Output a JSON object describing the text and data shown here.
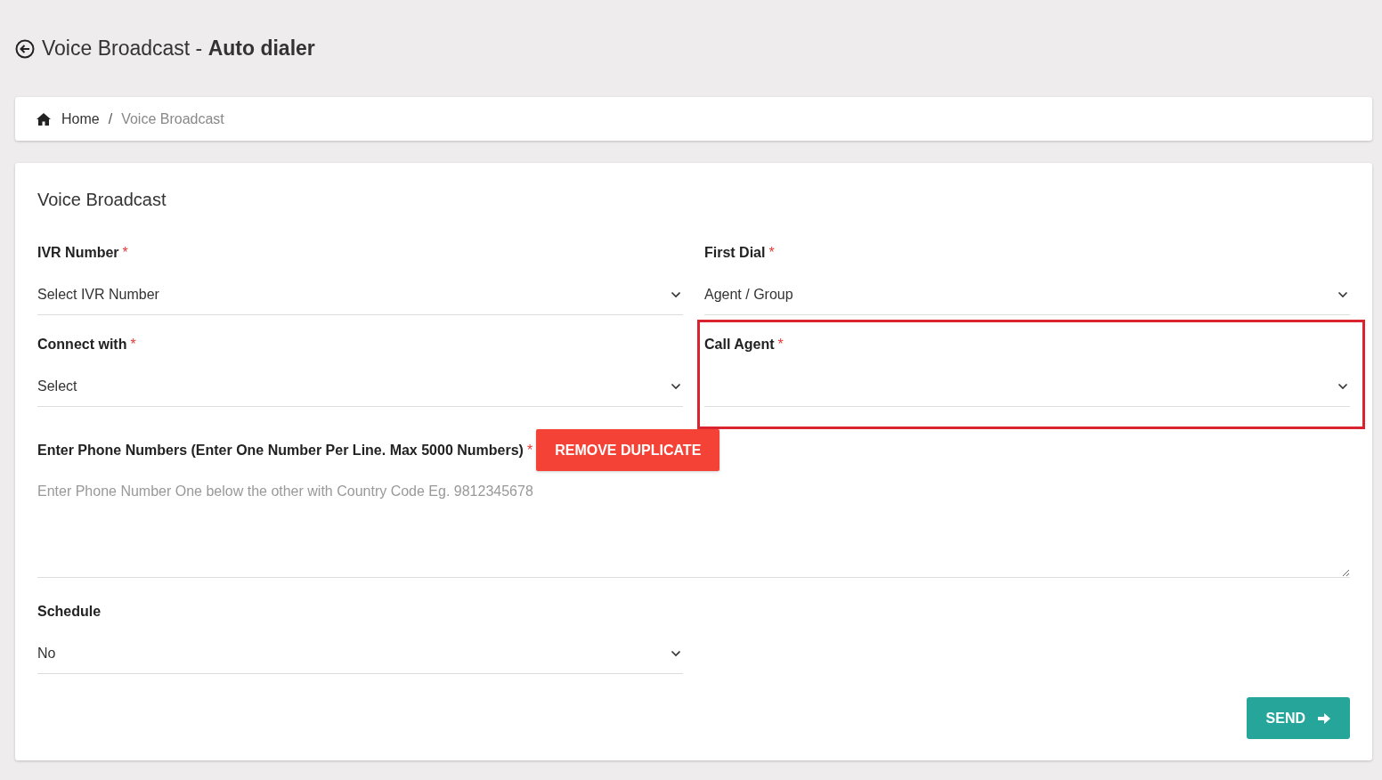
{
  "page_title": "Voice Broadcast - **Auto dialer**",
  "breadcrumb": [
    {
      "label": "Home",
      "kind": "home"
    },
    {
      "label": "Voice Broadcast",
      "kind": "current"
    }
  ],
  "breadcrumb_separator": "/",
  "form": {
    "title": "Voice Broadcast",
    "required_mark": "*",
    "fields": [
      {
        "label": "IVR Number",
        "required": true,
        "value": "Select IVR Number",
        "highlighted": false
      },
      {
        "label": "First Dial",
        "required": true,
        "value": "Agent / Group",
        "highlighted": false
      },
      {
        "label": "Connect with",
        "required": true,
        "value": "Select",
        "highlighted": false
      },
      {
        "label": "Call Agent",
        "required": true,
        "highlighted": true
      }
    ],
    "phone_numbers": {
      "label": "Enter Phone Numbers (Enter One Number Per Line. Max 5000 Numbers)",
      "required": true,
      "button": "REMOVE DUPLICATE",
      "placeholder": "Enter Phone Number One below the other with Country Code Eg. 9812345678"
    },
    "schedule": {
      "label": "Schedule",
      "required": false,
      "value": "No"
    },
    "submit": "SEND"
  }
}
